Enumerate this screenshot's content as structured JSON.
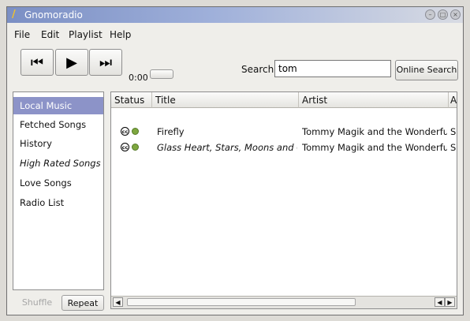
{
  "window": {
    "title": "Gnomoradio"
  },
  "menubar": {
    "items": [
      "File",
      "Edit",
      "Playlist",
      "Help"
    ]
  },
  "toolbar": {
    "prev_icon": "⏮",
    "play_icon": "▶",
    "next_icon": "⏭",
    "time": "0:00",
    "search_label": "Search:",
    "search_value": "tom",
    "online_search_label": "Online Search"
  },
  "sidebar": {
    "items": [
      {
        "label": "Local Music",
        "selected": true
      },
      {
        "label": "Fetched Songs"
      },
      {
        "label": "History"
      },
      {
        "label": "High Rated Songs",
        "italic": true
      },
      {
        "label": "Love Songs"
      },
      {
        "label": "Radio List"
      }
    ],
    "shuffle_label": "Shuffle",
    "repeat_label": "Repeat"
  },
  "list": {
    "columns": [
      "Status",
      "Title",
      "Artist",
      "A"
    ],
    "rows": [
      {
        "title": "Firefly",
        "artist": "Tommy Magik and the Wonderfulls",
        "extra": "S"
      },
      {
        "title": "Glass Heart, Stars, Moons and Cl",
        "artist": "Tommy Magik and the Wonderfulls",
        "extra": "S",
        "italic": true
      }
    ]
  },
  "colors": {
    "accent": "#8c93c8",
    "title_gradient_start": "#7b8fc4",
    "status_dot": "#7ea73f"
  }
}
